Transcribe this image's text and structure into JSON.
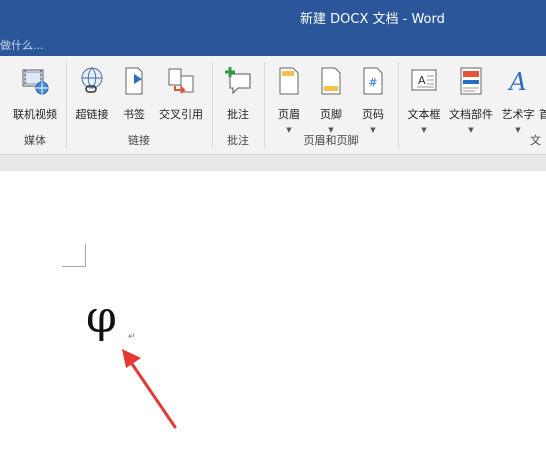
{
  "window": {
    "title": "新建 DOCX 文档 - Word"
  },
  "tell_me": {
    "placeholder": "做什么..."
  },
  "ribbon": {
    "buttons": {
      "online_video": "联机视频",
      "hyperlink": "超链接",
      "bookmark": "书签",
      "cross_reference": "交叉引用",
      "comment": "批注",
      "header": "页眉",
      "footer": "页脚",
      "page_number": "页码",
      "text_box": "文本框",
      "quick_parts": "文档部件",
      "wordart": "艺术字",
      "dropcap_partial": "首"
    },
    "groups": {
      "media": "媒体",
      "links": "链接",
      "comments": "批注",
      "header_footer": "页眉和页脚",
      "text_partial": "文"
    }
  },
  "document": {
    "symbol": "φ",
    "paragraph_mark": "↵"
  },
  "colors": {
    "titlebar": "#2b579a",
    "ribbon_bg": "#f3f3f3",
    "annotation_arrow": "#e53935"
  }
}
